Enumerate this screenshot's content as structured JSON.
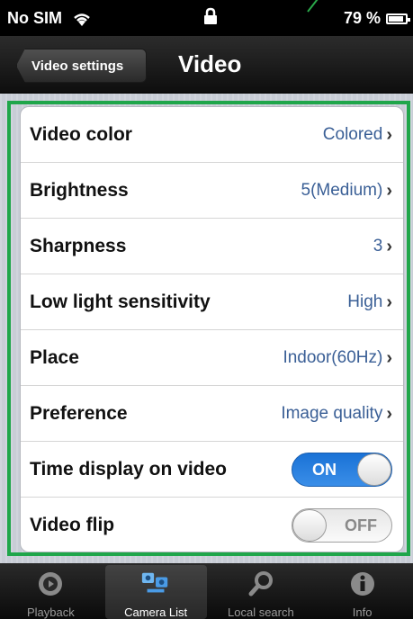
{
  "status_bar": {
    "carrier": "No SIM",
    "battery_percent": "79 %"
  },
  "nav": {
    "back_label": "Video settings",
    "title": "Video"
  },
  "settings": [
    {
      "label": "Video color",
      "value": "Colored"
    },
    {
      "label": "Brightness",
      "value": "5(Medium)"
    },
    {
      "label": "Sharpness",
      "value": "3"
    },
    {
      "label": "Low light sensitivity",
      "value": "High"
    },
    {
      "label": "Place",
      "value": "Indoor(60Hz)"
    },
    {
      "label": "Preference",
      "value": "Image quality"
    }
  ],
  "toggles": [
    {
      "label": "Time display on video",
      "state": "ON"
    },
    {
      "label": "Video flip",
      "state": "OFF"
    }
  ],
  "tabs": [
    {
      "label": "Playback",
      "icon": "playback-icon"
    },
    {
      "label": "Camera List",
      "icon": "camera-list-icon"
    },
    {
      "label": "Local search",
      "icon": "search-icon"
    },
    {
      "label": "Info",
      "icon": "info-icon"
    }
  ],
  "colors": {
    "highlight": "#1fa64a",
    "value_text": "#3a5f96",
    "toggle_on": "#1a72d6"
  }
}
